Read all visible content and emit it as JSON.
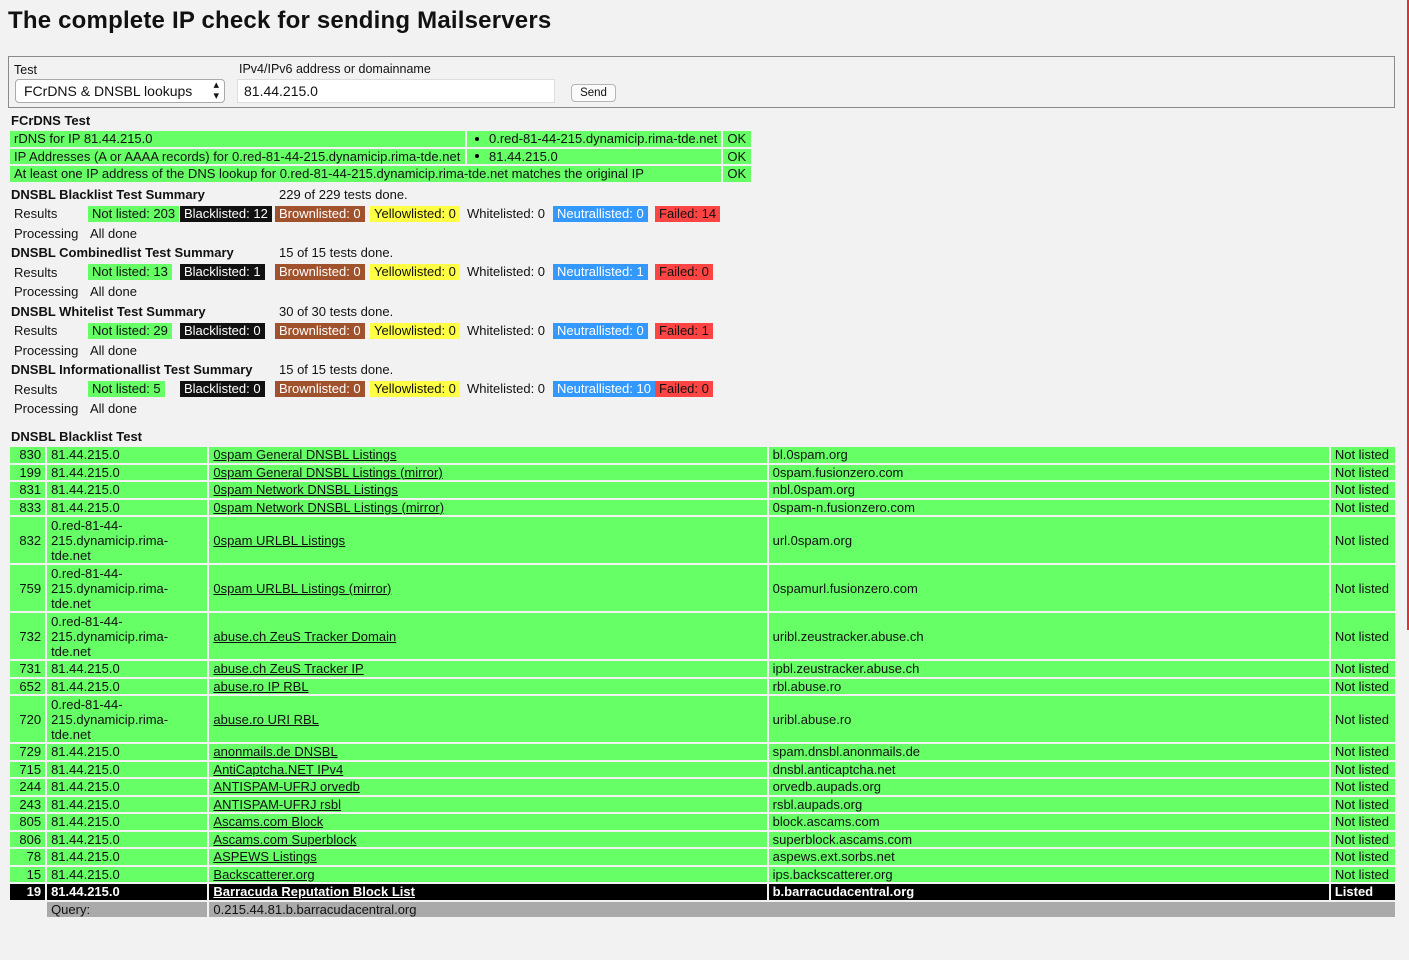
{
  "page_title": "The complete IP check for sending Mailservers",
  "form": {
    "test_label": "Test",
    "test_selected": "FCrDNS & DNSBL lookups",
    "address_label": "IPv4/IPv6 address or domainname",
    "address_value": "81.44.215.0",
    "send_label": "Send"
  },
  "fcrdns": {
    "title": "FCrDNS Test",
    "rows": [
      {
        "label": "rDNS for IP 81.44.215.0",
        "value": "0.red-81-44-215.dynamicip.rima-tde.net",
        "status": "OK"
      },
      {
        "label": "IP Addresses (A or AAAA records) for 0.red-81-44-215.dynamicip.rima-tde.net",
        "value": "81.44.215.0",
        "status": "OK"
      },
      {
        "label": "At least one IP address of the DNS lookup for 0.red-81-44-215.dynamicip.rima-tde.net matches the original IP",
        "status": "OK"
      }
    ]
  },
  "summaries": [
    {
      "title": "DNSBL Blacklist Test Summary",
      "done": "229 of 229 tests done.",
      "results_label": "Results",
      "not_listed": "Not listed: 203",
      "blacklisted": "Blacklisted: 12",
      "brownlisted": "Brownlisted: 0",
      "yellowlisted": "Yellowlisted: 0",
      "whitelisted": "Whitelisted: 0",
      "neutrallisted": "Neutrallisted: 0",
      "failed": "Failed: 14",
      "processing_label": "Processing",
      "processing_value": "All done"
    },
    {
      "title": "DNSBL Combinedlist Test Summary",
      "done": "15 of 15 tests done.",
      "results_label": "Results",
      "not_listed": "Not listed: 13",
      "blacklisted": "Blacklisted: 1",
      "brownlisted": "Brownlisted: 0",
      "yellowlisted": "Yellowlisted: 0",
      "whitelisted": "Whitelisted: 0",
      "neutrallisted": "Neutrallisted: 1",
      "failed": "Failed: 0",
      "processing_label": "Processing",
      "processing_value": "All done"
    },
    {
      "title": "DNSBL Whitelist Test Summary",
      "done": "30 of 30 tests done.",
      "results_label": "Results",
      "not_listed": "Not listed: 29",
      "blacklisted": "Blacklisted: 0",
      "brownlisted": "Brownlisted: 0",
      "yellowlisted": "Yellowlisted: 0",
      "whitelisted": "Whitelisted: 0",
      "neutrallisted": "Neutrallisted: 0",
      "failed": "Failed: 1",
      "processing_label": "Processing",
      "processing_value": "All done"
    },
    {
      "title": "DNSBL Informationallist Test Summary",
      "done": "15 of 15 tests done.",
      "results_label": "Results",
      "not_listed": "Not listed: 5",
      "blacklisted": "Blacklisted: 0",
      "brownlisted": "Brownlisted: 0",
      "yellowlisted": "Yellowlisted: 0",
      "whitelisted": "Whitelisted: 0",
      "neutrallisted": "Neutrallisted: 10",
      "failed": "Failed: 0",
      "processing_label": "Processing",
      "processing_value": "All done"
    }
  ],
  "blacklist": {
    "title": "DNSBL Blacklist Test",
    "rows": [
      {
        "id": "830",
        "ip": "81.44.215.0",
        "name": "0spam General DNSBL Listings",
        "zone": "bl.0spam.org",
        "status": "Not listed"
      },
      {
        "id": "199",
        "ip": "81.44.215.0",
        "name": "0spam General DNSBL Listings (mirror)",
        "zone": "0spam.fusionzero.com",
        "status": "Not listed"
      },
      {
        "id": "831",
        "ip": "81.44.215.0",
        "name": "0spam Network DNSBL Listings",
        "zone": "nbl.0spam.org",
        "status": "Not listed"
      },
      {
        "id": "833",
        "ip": "81.44.215.0",
        "name": "0spam Network DNSBL Listings (mirror)",
        "zone": "0spam-n.fusionzero.com",
        "status": "Not listed"
      },
      {
        "id": "832",
        "ip": "0.red-81-44-215.dynamicip.rima-tde.net",
        "name": "0spam URLBL Listings",
        "zone": "url.0spam.org",
        "status": "Not listed"
      },
      {
        "id": "759",
        "ip": "0.red-81-44-215.dynamicip.rima-tde.net",
        "name": "0spam URLBL Listings (mirror)",
        "zone": "0spamurl.fusionzero.com",
        "status": "Not listed"
      },
      {
        "id": "732",
        "ip": "0.red-81-44-215.dynamicip.rima-tde.net",
        "name": "abuse.ch ZeuS Tracker Domain",
        "zone": "uribl.zeustracker.abuse.ch",
        "status": "Not listed"
      },
      {
        "id": "731",
        "ip": "81.44.215.0",
        "name": "abuse.ch ZeuS Tracker IP",
        "zone": "ipbl.zeustracker.abuse.ch",
        "status": "Not listed"
      },
      {
        "id": "652",
        "ip": "81.44.215.0",
        "name": "abuse.ro IP RBL",
        "zone": "rbl.abuse.ro",
        "status": "Not listed"
      },
      {
        "id": "720",
        "ip": "0.red-81-44-215.dynamicip.rima-tde.net",
        "name": "abuse.ro URI RBL",
        "zone": "uribl.abuse.ro",
        "status": "Not listed"
      },
      {
        "id": "729",
        "ip": "81.44.215.0",
        "name": "anonmails.de DNSBL",
        "zone": "spam.dnsbl.anonmails.de",
        "status": "Not listed"
      },
      {
        "id": "715",
        "ip": "81.44.215.0",
        "name": "AntiCaptcha.NET IPv4",
        "zone": "dnsbl.anticaptcha.net",
        "status": "Not listed"
      },
      {
        "id": "244",
        "ip": "81.44.215.0",
        "name": "ANTISPAM-UFRJ orvedb",
        "zone": "orvedb.aupads.org",
        "status": "Not listed"
      },
      {
        "id": "243",
        "ip": "81.44.215.0",
        "name": "ANTISPAM-UFRJ rsbl",
        "zone": "rsbl.aupads.org",
        "status": "Not listed"
      },
      {
        "id": "805",
        "ip": "81.44.215.0",
        "name": "Ascams.com Block",
        "zone": "block.ascams.com",
        "status": "Not listed"
      },
      {
        "id": "806",
        "ip": "81.44.215.0",
        "name": "Ascams.com Superblock",
        "zone": "superblock.ascams.com",
        "status": "Not listed"
      },
      {
        "id": "78",
        "ip": "81.44.215.0",
        "name": "ASPEWS Listings",
        "zone": "aspews.ext.sorbs.net",
        "status": "Not listed"
      },
      {
        "id": "15",
        "ip": "81.44.215.0",
        "name": "Backscatterer.org",
        "zone": "ips.backscatterer.org",
        "status": "Not listed"
      },
      {
        "id": "19",
        "ip": "81.44.215.0",
        "name": "Barracuda Reputation Block List",
        "zone": "b.barracudacentral.org",
        "status": "Listed"
      }
    ],
    "query_label": "Query:",
    "query_value": "0.215.44.81.b.barracudacentral.org"
  }
}
